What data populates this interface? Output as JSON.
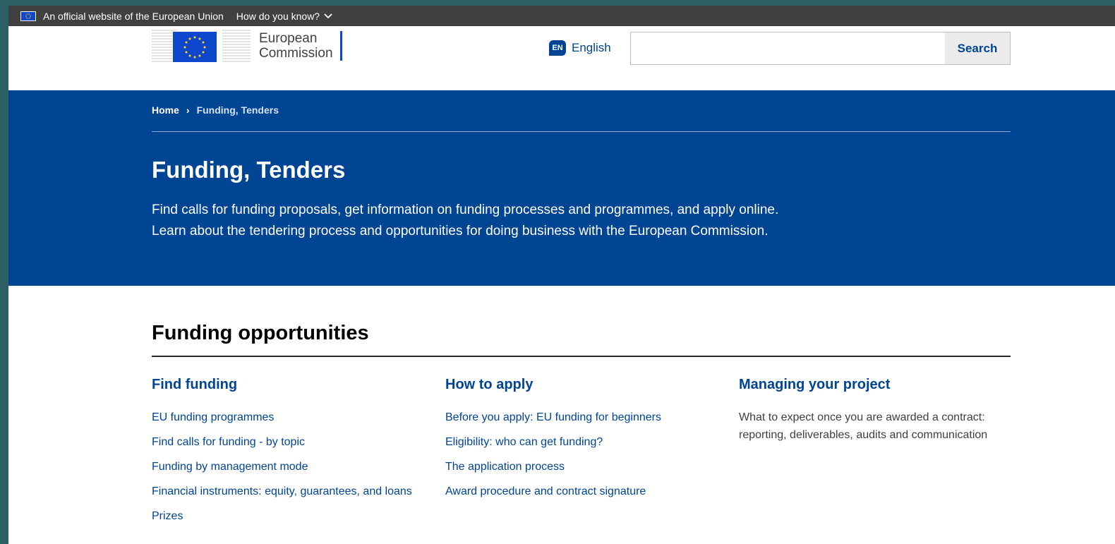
{
  "official_bar": {
    "text": "An official website of the European Union",
    "how_know": "How do you know?"
  },
  "header": {
    "logo_line1": "European",
    "logo_line2": "Commission",
    "lang_code": "EN",
    "lang_label": "English",
    "search_placeholder": "",
    "search_label": "Search"
  },
  "breadcrumb": {
    "home": "Home",
    "separator": "›",
    "current": "Funding, Tenders"
  },
  "hero": {
    "title": "Funding, Tenders",
    "description": "Find calls for funding proposals, get information on funding processes and programmes, and apply online. Learn about the tendering process and opportunities for doing business with the European Commission."
  },
  "section": {
    "title": "Funding opportunities",
    "columns": [
      {
        "heading": "Find funding",
        "links": [
          "EU funding programmes",
          "Find calls for funding - by topic",
          "Funding by management mode",
          "Financial instruments: equity, guarantees, and loans",
          "Prizes"
        ]
      },
      {
        "heading": "How to apply",
        "links": [
          "Before you apply: EU funding for beginners",
          "Eligibility: who can get funding?",
          "The application process",
          "Award procedure and contract signature"
        ]
      },
      {
        "heading": "Managing your project",
        "description": "What to expect once you are awarded a contract: reporting, deliverables, audits and communication"
      }
    ]
  },
  "colors": {
    "eu_blue": "#004494",
    "flag_blue": "#0e47cb",
    "flag_star": "#ffd617",
    "top_bar": "#404040"
  },
  "icons": {
    "eu_flag": "eu-flag-icon",
    "chevron": "chevron-down-icon",
    "language": "language-icon",
    "breadcrumb_sep": "chevron-right-icon"
  }
}
